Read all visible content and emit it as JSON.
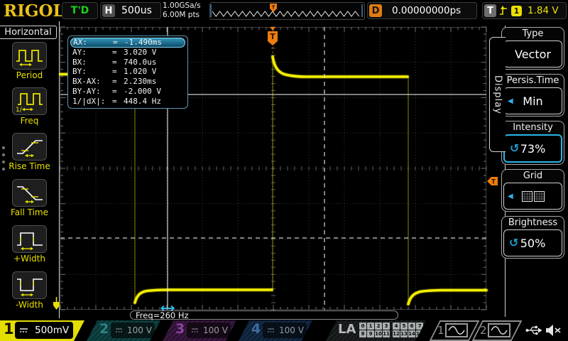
{
  "top_bar": {
    "logo": "RIGOL",
    "trig_status": "T'D",
    "h_label": "H",
    "timebase": "500us",
    "sample_rate": "1.00GSa/s",
    "mem_depth": "6.00M pts",
    "delay_label": "D",
    "delay_value": "0.00000000ps",
    "trig_label": "T",
    "trig_source": "1",
    "trig_level": "1.84 V"
  },
  "left_menu": {
    "title": "Horizontal",
    "items": [
      {
        "label": "Period",
        "icon": "period-icon"
      },
      {
        "label": "Freq",
        "icon": "freq-icon"
      },
      {
        "label": "Rise Time",
        "icon": "rise-time-icon"
      },
      {
        "label": "Fall Time",
        "icon": "fall-time-icon"
      },
      {
        "label": "+Width",
        "icon": "plus-width-icon"
      },
      {
        "label": "-Width",
        "icon": "minus-width-icon"
      }
    ]
  },
  "cursor_box": {
    "eq": "=",
    "rows": [
      {
        "label": "AX:",
        "value": "-1.490ms",
        "selected": true
      },
      {
        "label": "AY:",
        "value": "3.020 V"
      },
      {
        "label": "BX:",
        "value": "740.0us"
      },
      {
        "label": "BY:",
        "value": "1.020 V"
      },
      {
        "label": "BX-AX:",
        "value": "2.230ms"
      },
      {
        "label": "BY-AY:",
        "value": "-2.000 V"
      },
      {
        "label": "1/|dX|:",
        "value": "448.4 Hz"
      }
    ]
  },
  "right_menu": {
    "tab": "Display",
    "items": [
      {
        "label": "Type",
        "value": "Vector"
      },
      {
        "label": "Persis.Time",
        "value": "Min"
      },
      {
        "label": "Intensity",
        "value": "73%"
      },
      {
        "label": "Grid",
        "value": ""
      },
      {
        "label": "Brightness",
        "value": "50%"
      }
    ]
  },
  "freq_readout": "Freq=260 Hz",
  "channels": [
    {
      "id": "1",
      "scale": "500mV",
      "active": true
    },
    {
      "id": "2",
      "scale": "100 V",
      "active": false
    },
    {
      "id": "3",
      "scale": "100 V",
      "active": false
    },
    {
      "id": "4",
      "scale": "100 V",
      "active": false
    }
  ],
  "la": {
    "label": "LA",
    "digits": [
      "0",
      "1",
      "2",
      "3",
      "4",
      "5",
      "6",
      "7",
      "8",
      "9",
      "10",
      "11",
      "12",
      "13",
      "14",
      "15"
    ]
  },
  "math_channels": [
    {
      "id": "1",
      "icon": "sine-icon"
    },
    {
      "id": "2",
      "icon": "sine-icon"
    }
  ],
  "waveform": {
    "shape": "square",
    "frequency_readout": "260 Hz",
    "timebase_per_div": "500us",
    "ch1_scale_per_div": "500mV",
    "trigger_level": "1.84 V",
    "colors": {
      "trace": "#f1ed00",
      "trigger": "#ee7c0e",
      "cursor": "#ffffff",
      "accent": "#2ab5e8"
    }
  }
}
